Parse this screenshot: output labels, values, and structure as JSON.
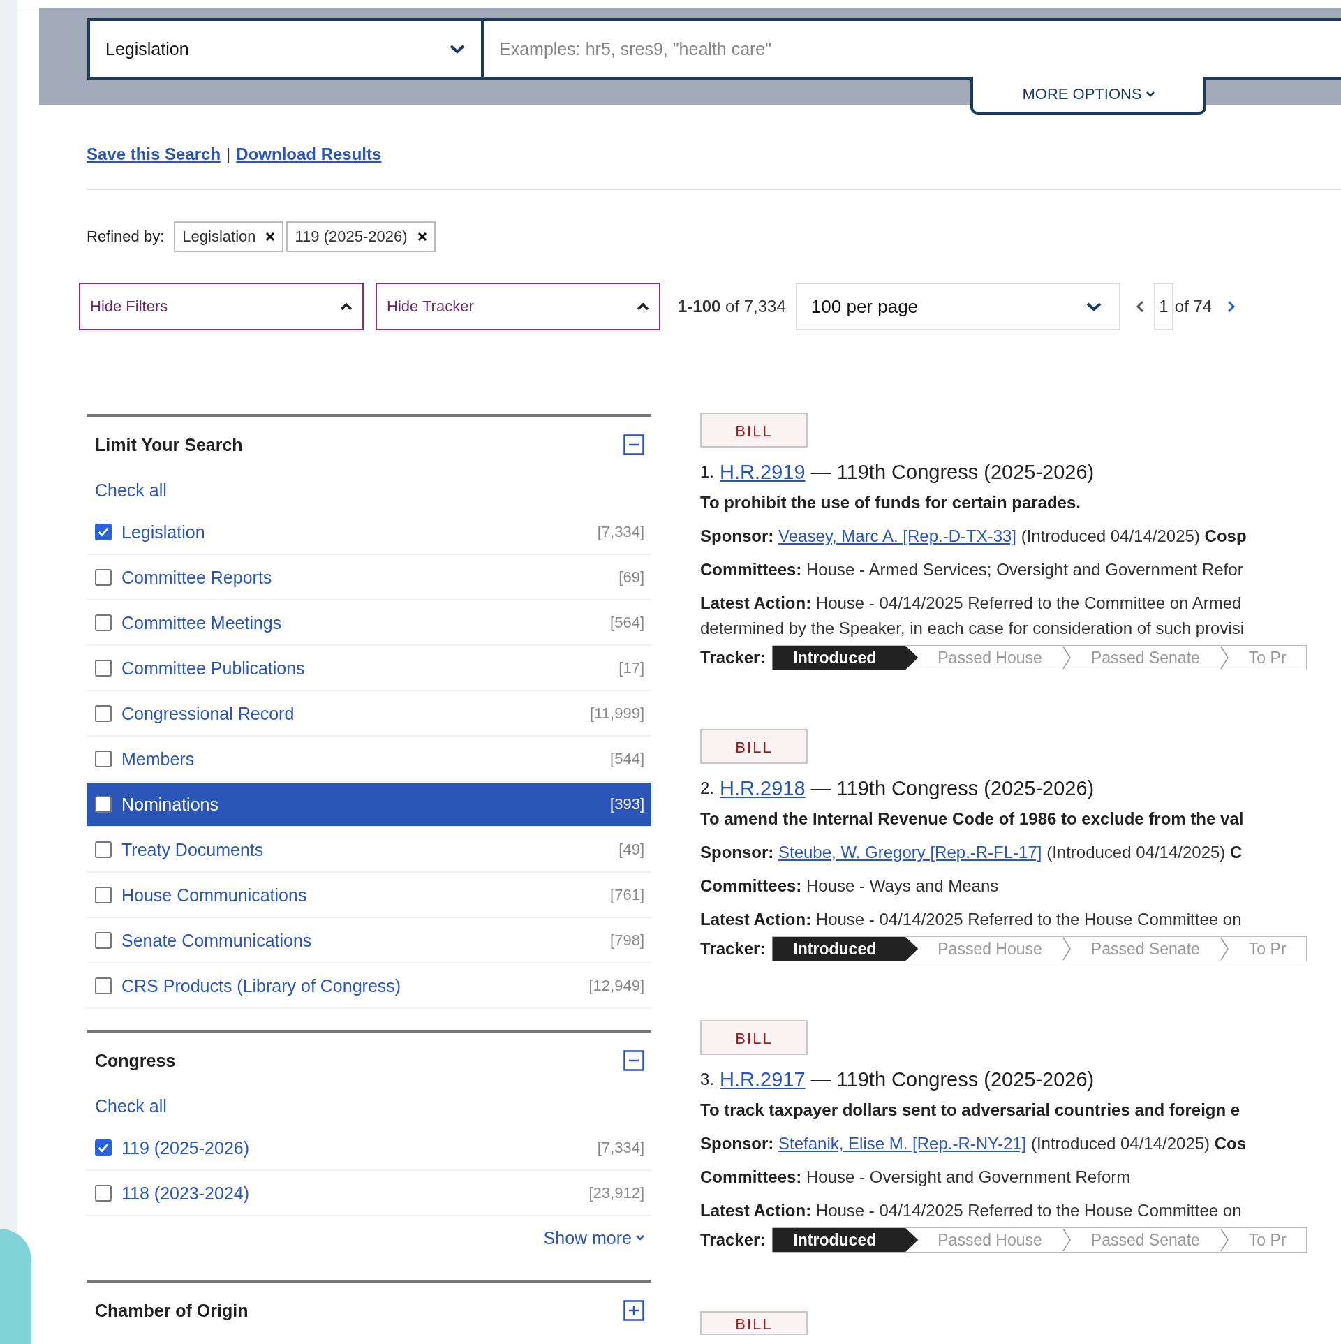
{
  "search": {
    "scope": "Legislation",
    "placeholder": "Examples: hr5, sres9, \"health care\"",
    "more_options": "MORE OPTIONS"
  },
  "actions": [
    {
      "label": "Save this Search"
    },
    {
      "label": "Download Results"
    }
  ],
  "actions_separator": "|",
  "refined_by": {
    "label": "Refined by:",
    "tags": [
      "Legislation",
      "119 (2025-2026)"
    ]
  },
  "controls": {
    "hide_filters": "Hide Filters",
    "hide_tracker": "Hide Tracker",
    "range": "**1-100** of 7,334",
    "per_page": "100 per page",
    "page": "1",
    "page_total": "of 74"
  },
  "filters": [
    {
      "title": "Limit Your Search",
      "expanded": true,
      "check_all": "Check all",
      "items": [
        {
          "label": "Legislation",
          "count": "[7,334]",
          "checked": true,
          "selected": false
        },
        {
          "label": "Committee Reports",
          "count": "[69]",
          "checked": false,
          "selected": false
        },
        {
          "label": "Committee Meetings",
          "count": "[564]",
          "checked": false,
          "selected": false
        },
        {
          "label": "Committee Publications",
          "count": "[17]",
          "checked": false,
          "selected": false
        },
        {
          "label": "Congressional Record",
          "count": "[11,999]",
          "checked": false,
          "selected": false
        },
        {
          "label": "Members",
          "count": "[544]",
          "checked": false,
          "selected": false
        },
        {
          "label": "Nominations",
          "count": "[393]",
          "checked": false,
          "selected": true
        },
        {
          "label": "Treaty Documents",
          "count": "[49]",
          "checked": false,
          "selected": false
        },
        {
          "label": "House Communications",
          "count": "[761]",
          "checked": false,
          "selected": false
        },
        {
          "label": "Senate Communications",
          "count": "[798]",
          "checked": false,
          "selected": false
        },
        {
          "label": "CRS Products (Library of Congress)",
          "count": "[12,949]",
          "checked": false,
          "selected": false
        }
      ]
    },
    {
      "title": "Congress",
      "expanded": true,
      "check_all": "Check all",
      "items": [
        {
          "label": "119 (2025-2026)",
          "count": "[7,334]",
          "checked": true,
          "selected": false
        },
        {
          "label": "118 (2023-2024)",
          "count": "[23,912]",
          "checked": false,
          "selected": false
        }
      ],
      "show_more": "Show more"
    },
    {
      "title": "Chamber of Origin",
      "expanded": false
    }
  ],
  "results": [
    {
      "type": "BILL",
      "number": "1.",
      "bill": "H.R.2919",
      "congress": "— 119th Congress (2025-2026)",
      "title": "To prohibit the use of funds for certain parades.",
      "sponsor": {
        "label": "Sponsor:",
        "name": "Veasey, Marc A. [Rep.-D-TX-33]",
        "after": "(Introduced 04/14/2025) **Cosp**"
      },
      "committees": "**Committees:** House - Armed Services; Oversight and Government Refor",
      "latest_action": [
        "**Latest Action:** House - 04/14/2025 Referred to the Committee on Armed",
        "determined by the Speaker, in each case for consideration of such provisi"
      ],
      "tracker": {
        "label": "Tracker:",
        "stages": [
          {
            "label": "Introduced",
            "reached": true
          },
          {
            "label": "Passed House",
            "reached": false
          },
          {
            "label": "Passed Senate",
            "reached": false
          },
          {
            "label": "To Pr",
            "reached": false
          }
        ]
      }
    },
    {
      "type": "BILL",
      "number": "2.",
      "bill": "H.R.2918",
      "congress": "— 119th Congress (2025-2026)",
      "title": "To amend the Internal Revenue Code of 1986 to exclude from the val",
      "sponsor": {
        "label": "Sponsor:",
        "name": "Steube, W. Gregory [Rep.-R-FL-17]",
        "after": "(Introduced 04/14/2025) **C**"
      },
      "committees": "**Committees:** House - Ways and Means",
      "latest_action": [
        "**Latest Action:** House - 04/14/2025 Referred to the House Committee on"
      ],
      "tracker": {
        "label": "Tracker:",
        "stages": [
          {
            "label": "Introduced",
            "reached": true
          },
          {
            "label": "Passed House",
            "reached": false
          },
          {
            "label": "Passed Senate",
            "reached": false
          },
          {
            "label": "To Pr",
            "reached": false
          }
        ]
      }
    },
    {
      "type": "BILL",
      "number": "3.",
      "bill": "H.R.2917",
      "congress": "— 119th Congress (2025-2026)",
      "title": "To track taxpayer dollars sent to adversarial countries and foreign e",
      "sponsor": {
        "label": "Sponsor:",
        "name": "Stefanik, Elise M. [Rep.-R-NY-21]",
        "after": "(Introduced 04/14/2025) **Cos**"
      },
      "committees": "**Committees:** House - Oversight and Government Reform",
      "latest_action": [
        "**Latest Action:** House - 04/14/2025 Referred to the House Committee on"
      ],
      "tracker": {
        "label": "Tracker:",
        "stages": [
          {
            "label": "Introduced",
            "reached": true
          },
          {
            "label": "Passed House",
            "reached": false
          },
          {
            "label": "Passed Senate",
            "reached": false
          },
          {
            "label": "To Pr",
            "reached": false
          }
        ]
      }
    },
    {
      "type": "BILL"
    }
  ]
}
